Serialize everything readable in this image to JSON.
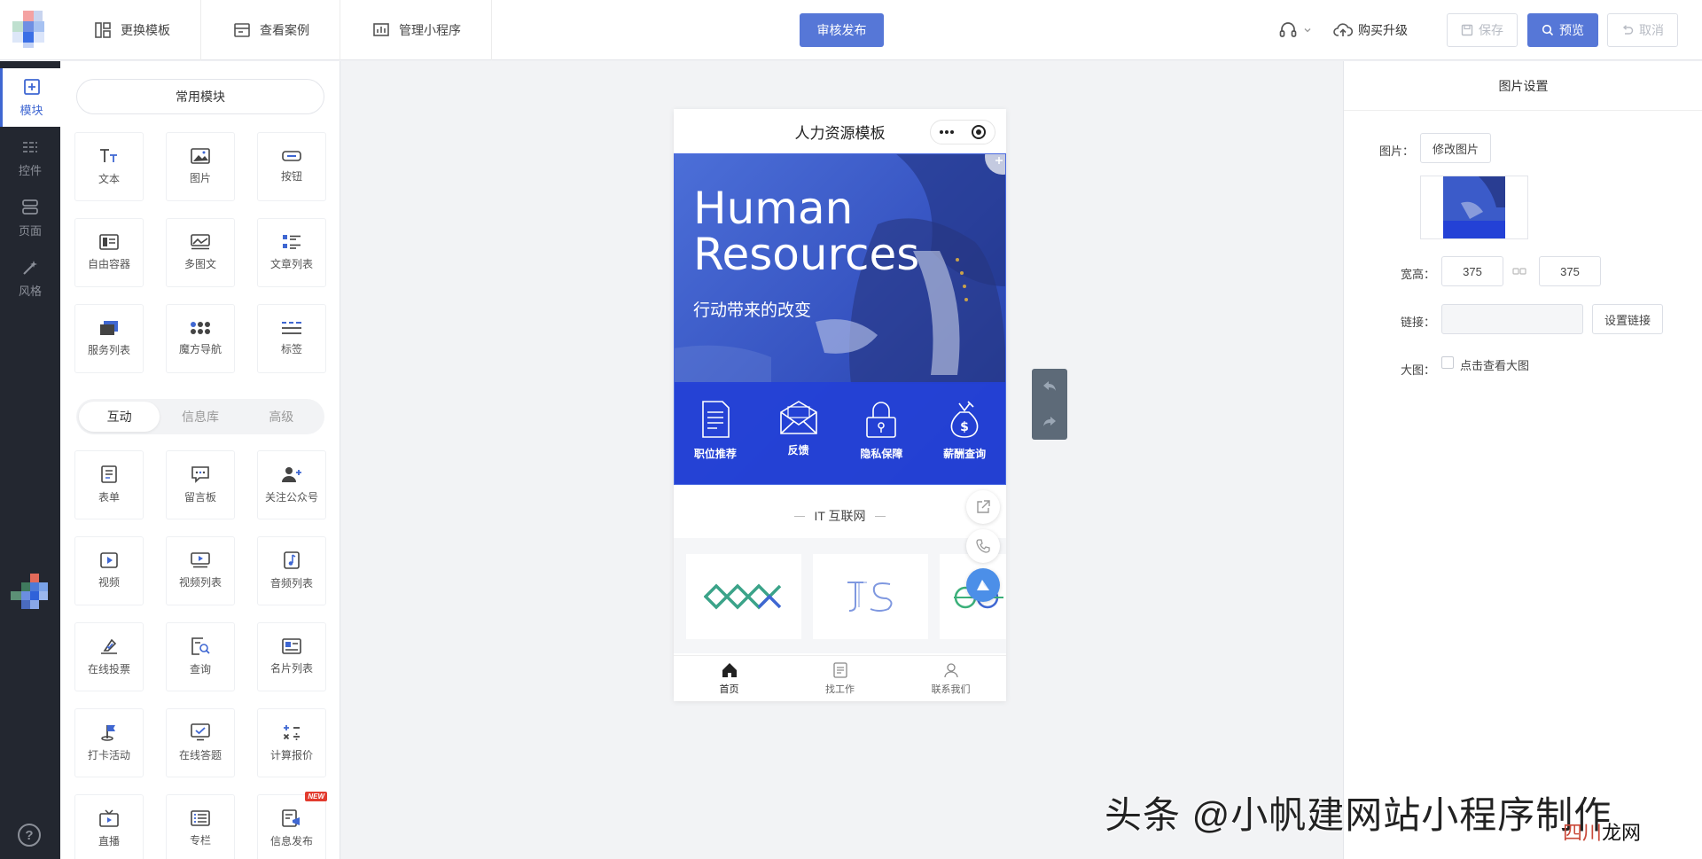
{
  "topbar": {
    "nav": [
      "更换模板",
      "查看案例",
      "管理小程序"
    ],
    "publish": "审核发布",
    "buy": "购买升级",
    "save": "保存",
    "preview": "预览",
    "cancel": "取消"
  },
  "leftbar": {
    "items": [
      "模块",
      "控件",
      "页面",
      "风格"
    ],
    "help": "?"
  },
  "panel": {
    "common_title": "常用模块",
    "common": [
      "文本",
      "图片",
      "按钮",
      "自由容器",
      "多图文",
      "文章列表",
      "服务列表",
      "魔方导航",
      "标签"
    ],
    "tabs": [
      "互动",
      "信息库",
      "高级"
    ],
    "interactive": [
      "表单",
      "留言板",
      "关注公众号",
      "视频",
      "视频列表",
      "音频列表",
      "在线投票",
      "查询",
      "名片列表",
      "打卡活动",
      "在线答题",
      "计算报价",
      "直播",
      "专栏",
      "信息发布"
    ],
    "new_badge": "NEW"
  },
  "phone": {
    "title": "人力资源模板",
    "banner_title": "Human Resources",
    "banner_sub": "行动带来的改变",
    "icons": [
      "职位推荐",
      "反馈",
      "隐私保障",
      "薪酬查询"
    ],
    "section_title": "IT 互联网",
    "tabbar": [
      "首页",
      "找工作",
      "联系我们"
    ]
  },
  "rpanel": {
    "title": "图片设置",
    "image_label": "图片：",
    "modify_btn": "修改图片",
    "size_label": "宽高：",
    "width": "375",
    "height": "375",
    "link_label": "链接：",
    "link_btn": "设置链接",
    "big_label": "大图：",
    "big_check": "点击查看大图"
  },
  "watermark": {
    "main": "头条 @小帆建网站小程序制作",
    "small_red": "四川",
    "small_black": "龙网"
  },
  "colors": {
    "accent": "#5677d7",
    "sidebar": "#232730",
    "banner_blue": "#2e4fd4"
  }
}
